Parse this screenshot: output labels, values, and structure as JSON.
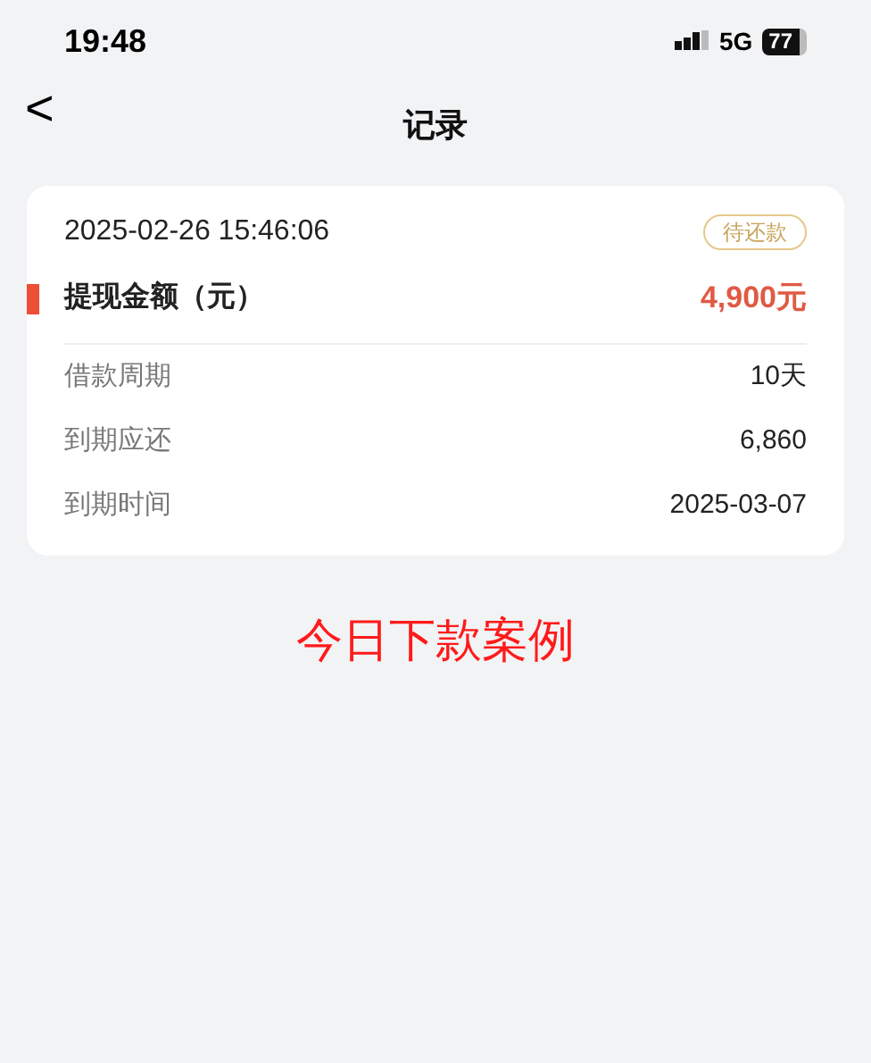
{
  "status_bar": {
    "time": "19:48",
    "network": "5G",
    "battery": "77"
  },
  "nav": {
    "back": "<",
    "title": "记录"
  },
  "record": {
    "datetime": "2025-02-26 15:46:06",
    "badge": "待还款",
    "amount_label": "提现金额（元）",
    "amount": "4,900元",
    "details": [
      {
        "label": "借款周期",
        "value": "10天"
      },
      {
        "label": "到期应还",
        "value": "6,860"
      },
      {
        "label": "到期时间",
        "value": "2025-03-07"
      }
    ]
  },
  "caption": "今日下款案例"
}
